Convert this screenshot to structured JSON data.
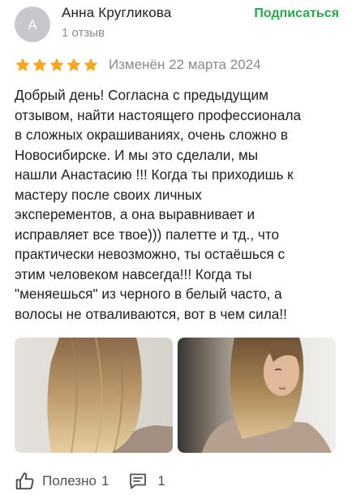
{
  "review": {
    "avatar_letter": "А",
    "author": "Анна Кругликова",
    "reviews_count": "1 отзыв",
    "subscribe_label": "Подписаться",
    "rating": 5,
    "rating_max": 5,
    "date": "Изменён 22 марта 2024",
    "text": "Добрый день! Согласна с предыдущим\nотзывом, найти настоящего профессионала\nв сложных окрашиваниях, очень сложно в\nНовосибирске. И мы это сделали, мы\nнашли Анастасию !!! Когда ты приходишь к\nмастеру после своих личных\nэксперементов, а она выравнивает и\nисправляет все твое))) палетте и тд., что\nпрактически невозможно, ты остаёшься с\nэтим человеком навсегда!!! Когда ты\n\"меняешься\" из черного в белый часто, а\nволосы не отваливаются, вот в чем сила!!"
  },
  "footer": {
    "useful_label": "Полезно",
    "useful_count": "1",
    "comments_count": "1"
  },
  "colors": {
    "star": "#f5a623",
    "subscribe": "#2da44e",
    "muted": "#8a8a8a"
  }
}
